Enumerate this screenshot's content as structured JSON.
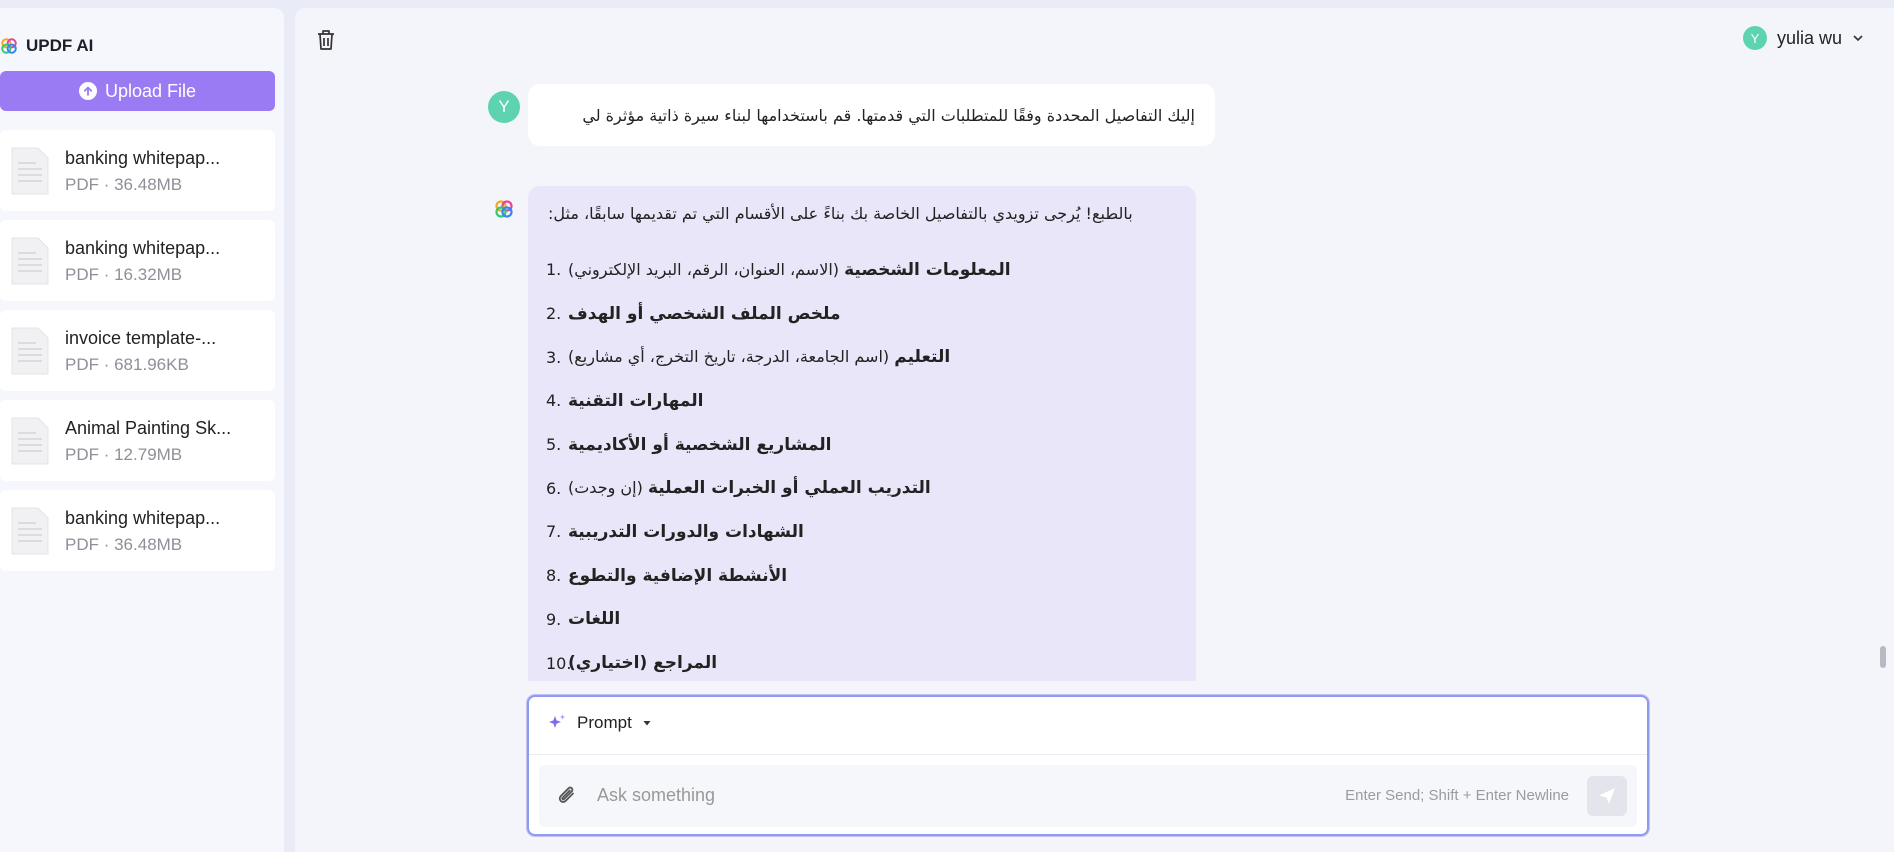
{
  "sidebar": {
    "brand": "UPDF AI",
    "upload_label": "Upload File",
    "files": [
      {
        "name": "banking whitepap...",
        "meta": "PDF · 36.48MB"
      },
      {
        "name": "banking whitepap...",
        "meta": "PDF · 16.32MB"
      },
      {
        "name": "invoice template-...",
        "meta": "PDF · 681.96KB"
      },
      {
        "name": "Animal Painting Sk...",
        "meta": "PDF · 12.79MB"
      },
      {
        "name": "banking whitepap...",
        "meta": "PDF · 36.48MB"
      }
    ]
  },
  "header": {
    "user_initial": "Y",
    "user_name": "yulia wu"
  },
  "chat": {
    "user_initial": "Y",
    "user_message": "إليك التفاصيل المحددة وفقًا للمتطلبات التي قدمتها. قم باستخدامها لبناء سيرة ذاتية مؤثرة لي",
    "ai_intro": "بالطبع! يُرجى تزويدي بالتفاصيل الخاصة بك بناءً على الأقسام التي تم تقديمها سابقًا، مثل:",
    "ai_items": [
      {
        "num": "1.",
        "bold": "المعلومات الشخصية",
        "rest": " (الاسم، العنوان، الرقم، البريد الإلكتروني)"
      },
      {
        "num": "2.",
        "bold": "ملخص الملف الشخصي أو الهدف",
        "rest": ""
      },
      {
        "num": "3.",
        "bold": "التعليم",
        "rest": " (اسم الجامعة، الدرجة، تاريخ التخرج، أي مشاريع)"
      },
      {
        "num": "4.",
        "bold": "المهارات التقنية",
        "rest": ""
      },
      {
        "num": "5.",
        "bold": "المشاريع الشخصية أو الأكاديمية",
        "rest": ""
      },
      {
        "num": "6.",
        "bold": "التدريب العملي أو الخبرات العملية",
        "rest": " (إن وجدت)"
      },
      {
        "num": "7.",
        "bold": "الشهادات والدورات التدريبية",
        "rest": ""
      },
      {
        "num": "8.",
        "bold": "الأنشطة الإضافية والتطوع",
        "rest": ""
      },
      {
        "num": "9.",
        "bold": "اللغات",
        "rest": ""
      },
      {
        "num": "10.",
        "bold": "المراجع (اختياري)",
        "rest": ""
      }
    ]
  },
  "composer": {
    "prompt_label": "Prompt",
    "placeholder": "Ask something",
    "hint": "Enter Send; Shift + Enter Newline"
  },
  "colors": {
    "accent": "#9b7bf4",
    "avatar": "#5ed3b0",
    "ai_bubble": "#e8e6f8"
  }
}
